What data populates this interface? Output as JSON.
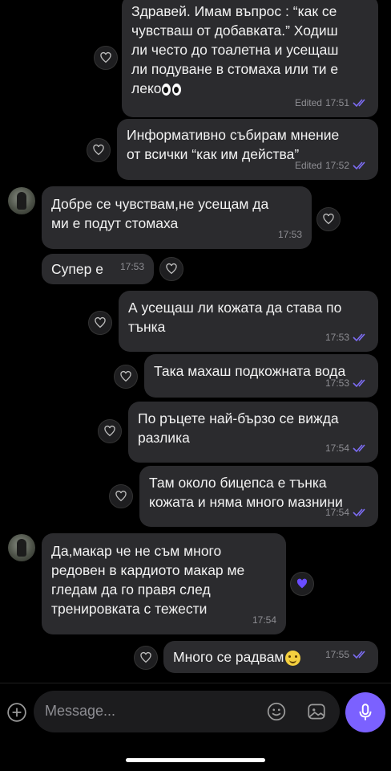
{
  "messages": [
    {
      "text": "Здравей. Имам въпрос : “как се\nчувстваш от добавката.” Ходиш\nли често до тоалетна и усещаш\nли подуване в стомаха или ти е\nлеко",
      "edited": "Edited",
      "time": "17:51"
    },
    {
      "text": "Информативно събирам мнение\nот всички “как им действа”",
      "edited": "Edited",
      "time": "17:52"
    },
    {
      "text": "Добре се чувствам,не усещам да\nми е подут стомаха",
      "time": "17:53"
    },
    {
      "text": "Супер е",
      "time": "17:53"
    },
    {
      "text": "А усещаш ли кожата да става по\nтънка",
      "time": "17:53"
    },
    {
      "text": "Така махаш подкожната вода",
      "time": "17:53"
    },
    {
      "text": "По ръцете най-бързо се вижда\nразлика",
      "time": "17:54"
    },
    {
      "text": "Там около бицепса е тънка\nкожата и няма много мазнини",
      "time": "17:54"
    },
    {
      "text": "Да,макар че не съм много\nредовен в кардиото макар ме\nгледам да го правя след\nтренировката с тежести",
      "time": "17:54"
    },
    {
      "text": "Много се радвам",
      "time": "17:55"
    }
  ],
  "composer": {
    "placeholder": "Message..."
  },
  "colors": {
    "accent": "#7b61ff",
    "bubble": "#2b2b2e",
    "ticks": "#7c6cf2",
    "reaction_filled": "#6a4cff"
  },
  "icons": [
    "heart-icon",
    "double-check-icon",
    "add-icon",
    "emoji-icon",
    "sticker-icon",
    "microphone-icon"
  ]
}
